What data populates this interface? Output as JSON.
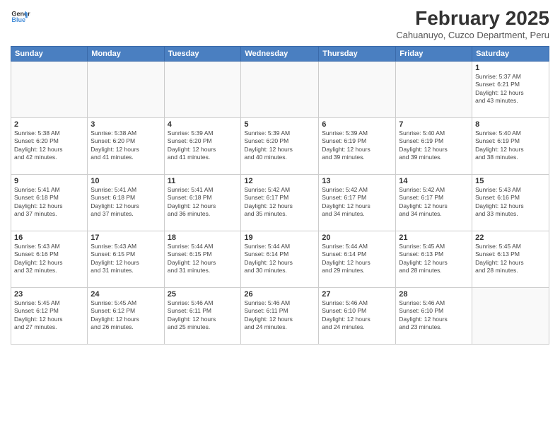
{
  "header": {
    "logo_line1": "General",
    "logo_line2": "Blue",
    "title": "February 2025",
    "subtitle": "Cahuanuyo, Cuzco Department, Peru"
  },
  "weekdays": [
    "Sunday",
    "Monday",
    "Tuesday",
    "Wednesday",
    "Thursday",
    "Friday",
    "Saturday"
  ],
  "weeks": [
    [
      {
        "day": "",
        "info": ""
      },
      {
        "day": "",
        "info": ""
      },
      {
        "day": "",
        "info": ""
      },
      {
        "day": "",
        "info": ""
      },
      {
        "day": "",
        "info": ""
      },
      {
        "day": "",
        "info": ""
      },
      {
        "day": "1",
        "info": "Sunrise: 5:37 AM\nSunset: 6:21 PM\nDaylight: 12 hours\nand 43 minutes."
      }
    ],
    [
      {
        "day": "2",
        "info": "Sunrise: 5:38 AM\nSunset: 6:20 PM\nDaylight: 12 hours\nand 42 minutes."
      },
      {
        "day": "3",
        "info": "Sunrise: 5:38 AM\nSunset: 6:20 PM\nDaylight: 12 hours\nand 41 minutes."
      },
      {
        "day": "4",
        "info": "Sunrise: 5:39 AM\nSunset: 6:20 PM\nDaylight: 12 hours\nand 41 minutes."
      },
      {
        "day": "5",
        "info": "Sunrise: 5:39 AM\nSunset: 6:20 PM\nDaylight: 12 hours\nand 40 minutes."
      },
      {
        "day": "6",
        "info": "Sunrise: 5:39 AM\nSunset: 6:19 PM\nDaylight: 12 hours\nand 39 minutes."
      },
      {
        "day": "7",
        "info": "Sunrise: 5:40 AM\nSunset: 6:19 PM\nDaylight: 12 hours\nand 39 minutes."
      },
      {
        "day": "8",
        "info": "Sunrise: 5:40 AM\nSunset: 6:19 PM\nDaylight: 12 hours\nand 38 minutes."
      }
    ],
    [
      {
        "day": "9",
        "info": "Sunrise: 5:41 AM\nSunset: 6:18 PM\nDaylight: 12 hours\nand 37 minutes."
      },
      {
        "day": "10",
        "info": "Sunrise: 5:41 AM\nSunset: 6:18 PM\nDaylight: 12 hours\nand 37 minutes."
      },
      {
        "day": "11",
        "info": "Sunrise: 5:41 AM\nSunset: 6:18 PM\nDaylight: 12 hours\nand 36 minutes."
      },
      {
        "day": "12",
        "info": "Sunrise: 5:42 AM\nSunset: 6:17 PM\nDaylight: 12 hours\nand 35 minutes."
      },
      {
        "day": "13",
        "info": "Sunrise: 5:42 AM\nSunset: 6:17 PM\nDaylight: 12 hours\nand 34 minutes."
      },
      {
        "day": "14",
        "info": "Sunrise: 5:42 AM\nSunset: 6:17 PM\nDaylight: 12 hours\nand 34 minutes."
      },
      {
        "day": "15",
        "info": "Sunrise: 5:43 AM\nSunset: 6:16 PM\nDaylight: 12 hours\nand 33 minutes."
      }
    ],
    [
      {
        "day": "16",
        "info": "Sunrise: 5:43 AM\nSunset: 6:16 PM\nDaylight: 12 hours\nand 32 minutes."
      },
      {
        "day": "17",
        "info": "Sunrise: 5:43 AM\nSunset: 6:15 PM\nDaylight: 12 hours\nand 31 minutes."
      },
      {
        "day": "18",
        "info": "Sunrise: 5:44 AM\nSunset: 6:15 PM\nDaylight: 12 hours\nand 31 minutes."
      },
      {
        "day": "19",
        "info": "Sunrise: 5:44 AM\nSunset: 6:14 PM\nDaylight: 12 hours\nand 30 minutes."
      },
      {
        "day": "20",
        "info": "Sunrise: 5:44 AM\nSunset: 6:14 PM\nDaylight: 12 hours\nand 29 minutes."
      },
      {
        "day": "21",
        "info": "Sunrise: 5:45 AM\nSunset: 6:13 PM\nDaylight: 12 hours\nand 28 minutes."
      },
      {
        "day": "22",
        "info": "Sunrise: 5:45 AM\nSunset: 6:13 PM\nDaylight: 12 hours\nand 28 minutes."
      }
    ],
    [
      {
        "day": "23",
        "info": "Sunrise: 5:45 AM\nSunset: 6:12 PM\nDaylight: 12 hours\nand 27 minutes."
      },
      {
        "day": "24",
        "info": "Sunrise: 5:45 AM\nSunset: 6:12 PM\nDaylight: 12 hours\nand 26 minutes."
      },
      {
        "day": "25",
        "info": "Sunrise: 5:46 AM\nSunset: 6:11 PM\nDaylight: 12 hours\nand 25 minutes."
      },
      {
        "day": "26",
        "info": "Sunrise: 5:46 AM\nSunset: 6:11 PM\nDaylight: 12 hours\nand 24 minutes."
      },
      {
        "day": "27",
        "info": "Sunrise: 5:46 AM\nSunset: 6:10 PM\nDaylight: 12 hours\nand 24 minutes."
      },
      {
        "day": "28",
        "info": "Sunrise: 5:46 AM\nSunset: 6:10 PM\nDaylight: 12 hours\nand 23 minutes."
      },
      {
        "day": "",
        "info": ""
      }
    ]
  ]
}
